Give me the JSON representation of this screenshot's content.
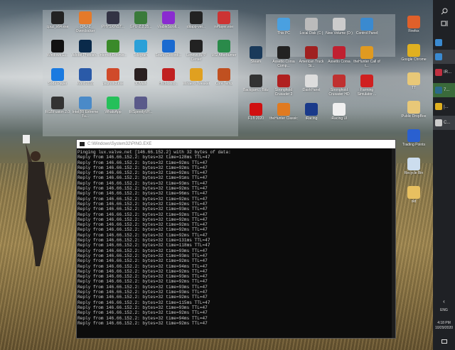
{
  "desktop": {
    "left_group": [
      {
        "label": "cpuz_x64.exe",
        "color": "#222"
      },
      {
        "label": "CPU-Z Overclocker",
        "color": "#e57a2a"
      },
      {
        "label": "PHYSXINST...",
        "color": "#334"
      },
      {
        "label": "GPU-Z.2.35...",
        "color": "#3a7a3a"
      },
      {
        "label": "ViableScroll...",
        "color": "#8a2bd0"
      },
      {
        "label": "ditapp-ver...",
        "color": "#222"
      },
      {
        "label": "nPlayer.exe",
        "color": "#c33"
      },
      {
        "label": "Windows Ei...",
        "color": "#111"
      },
      {
        "label": "Adobe Photosh...",
        "color": "#0a2a4a"
      },
      {
        "label": "Internet Downlo...",
        "color": "#3a8a2a"
      },
      {
        "label": "Telegram",
        "color": "#2aa0d8"
      },
      {
        "label": "Sound Recordi...",
        "color": "#1a6ad0"
      },
      {
        "label": "Lenovo APP Center",
        "color": "#222"
      },
      {
        "label": "MSI Afterburner",
        "color": "#2a8a4a"
      },
      {
        "label": "Soda Player",
        "color": "#1a7ae0"
      },
      {
        "label": "Word 2016",
        "color": "#2a5aa8"
      },
      {
        "label": "psiphon3.exe",
        "color": "#d04a2a"
      },
      {
        "label": "3DMark",
        "color": "#2a2020"
      },
      {
        "label": "HWMonito...",
        "color": "#c02020"
      },
      {
        "label": "Winaero Tweaker",
        "color": "#e0a020"
      },
      {
        "label": "Core Temp",
        "color": "#c05020"
      },
      {
        "label": "RGBFusion 2.0",
        "color": "#333"
      },
      {
        "label": "Intel(R) Extreme Tu...",
        "color": "#4a8ac8"
      },
      {
        "label": "WhatsApp",
        "color": "#25c05a"
      },
      {
        "label": "IRSpeedyVP...",
        "color": "#5a5a8a"
      }
    ],
    "right_group": [
      {
        "label": "",
        "color": ""
      },
      {
        "label": "This PC",
        "color": "#4aa0e0"
      },
      {
        "label": "Local Disk (C:)",
        "color": "#bbb"
      },
      {
        "label": "New Volume (D:)",
        "color": "#ccc"
      },
      {
        "label": "Control Panel",
        "color": "#3a8ad0"
      },
      {
        "label": "Steam",
        "color": "#1a3a5a"
      },
      {
        "label": "Assetto Corsa Comp...",
        "color": "#222"
      },
      {
        "label": "American Truck Si...",
        "color": "#a02020"
      },
      {
        "label": "Assetto Corsa",
        "color": "#c02030"
      },
      {
        "label": "theHunter Call of t...",
        "color": "#e09a20"
      },
      {
        "label": "Backgam... Blitz",
        "color": "#333"
      },
      {
        "label": "Stronghold Crusader 2",
        "color": "#b02020"
      },
      {
        "label": "DashPanel",
        "color": "#ddd"
      },
      {
        "label": "Stronghold Crusader HD",
        "color": "#c03030"
      },
      {
        "label": "Farming Simulator ...",
        "color": "#d02020"
      },
      {
        "label": "F1® 2020",
        "color": "#d01010"
      },
      {
        "label": "theHunter Classic",
        "color": "#e07a20"
      },
      {
        "label": "iRacing",
        "color": "#1a3a8a"
      },
      {
        "label": "iRacing UI",
        "color": "#f0f0f0"
      }
    ],
    "right_column": [
      {
        "label": "Firefox",
        "color": "#e0602a"
      },
      {
        "label": "Google Chrome",
        "color": "#e0b020"
      },
      {
        "label": "TT",
        "color": "#e8c878"
      },
      {
        "label": "Public DropBox",
        "color": "#e8c878"
      },
      {
        "label": "Trading Points",
        "color": "#2a60d0"
      },
      {
        "label": "Recycle Bin",
        "color": "#cde"
      },
      {
        "label": "old",
        "color": "#e8c060"
      }
    ]
  },
  "cmd": {
    "title": "C:\\Windows\\System32\\PING.EXE",
    "header": "Pinging lux.valve.net [146.66.152.2] with 32 bytes of data:",
    "reply_prefix": "Reply from 146.66.152.2: bytes=32 time=",
    "reply_suffix": "ms TTL=47",
    "times_ms": [
      128,
      92,
      92,
      92,
      91,
      93,
      92,
      96,
      92,
      92,
      93,
      92,
      92,
      92,
      92,
      92,
      131,
      118,
      93,
      93,
      92,
      94,
      92,
      93,
      92,
      93,
      93,
      92,
      115,
      93,
      92,
      94,
      92
    ]
  },
  "taskbar": {
    "items": [
      {
        "label": "",
        "icon": "desktop-icon",
        "color": "#3a8ad0"
      },
      {
        "label": "",
        "icon": "window-icon",
        "color": "#3a8ad0"
      },
      {
        "label": "IR...",
        "icon": "irspeedy-icon",
        "color": "#c03040"
      },
      {
        "label": "7...",
        "icon": "vpn-icon",
        "color": "#2a6a8a"
      },
      {
        "label": "إ...",
        "icon": "chrome-icon",
        "color": "#e0b020"
      },
      {
        "label": "C...",
        "icon": "cmd-icon",
        "color": "#ccc"
      }
    ],
    "language": "ENG",
    "time": "4:18 PM",
    "date": "10/29/2020"
  }
}
